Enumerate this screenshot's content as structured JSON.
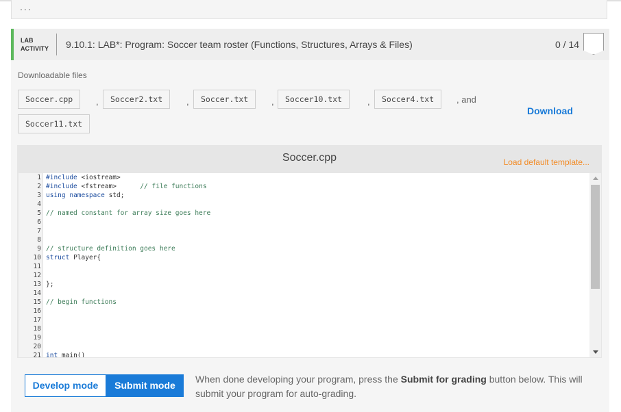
{
  "prev_section": {
    "ellipsis": "..."
  },
  "lab": {
    "type_line1": "LAB",
    "type_line2": "ACTIVITY",
    "title": "9.10.1: LAB*: Program: Soccer team roster (Functions, Structures, Arrays & Files)",
    "score": "0 / 14",
    "accent_color": "#5cb85c"
  },
  "downloads": {
    "title": "Downloadable files",
    "files": [
      "Soccer.cpp",
      "Soccer2.txt",
      "Soccer.txt",
      "Soccer10.txt",
      "Soccer4.txt",
      "Soccer11.txt"
    ],
    "separator": ",",
    "and_text": ", and",
    "download_label": "Download"
  },
  "editor": {
    "file_name": "Soccer.cpp",
    "load_default_label": "Load default template...",
    "lines": [
      {
        "n": "1",
        "code": "#include <iostream>"
      },
      {
        "n": "2",
        "code": "#include <fstream>      // file functions"
      },
      {
        "n": "3",
        "code": "using namespace std;"
      },
      {
        "n": "4",
        "code": ""
      },
      {
        "n": "5",
        "code": "// named constant for array size goes here"
      },
      {
        "n": "6",
        "code": ""
      },
      {
        "n": "7",
        "code": ""
      },
      {
        "n": "8",
        "code": ""
      },
      {
        "n": "9",
        "code": "// structure definition goes here"
      },
      {
        "n": "10",
        "code": "struct Player{"
      },
      {
        "n": "11",
        "code": ""
      },
      {
        "n": "12",
        "code": ""
      },
      {
        "n": "13",
        "code": "};"
      },
      {
        "n": "14",
        "code": ""
      },
      {
        "n": "15",
        "code": "// begin functions"
      },
      {
        "n": "16",
        "code": ""
      },
      {
        "n": "17",
        "code": ""
      },
      {
        "n": "18",
        "code": ""
      },
      {
        "n": "19",
        "code": ""
      },
      {
        "n": "20",
        "code": ""
      },
      {
        "n": "21",
        "code": "int main()"
      }
    ]
  },
  "modes": {
    "develop_label": "Develop mode",
    "submit_label": "Submit mode",
    "active": "Submit mode",
    "accent_color": "#1a7bd8"
  },
  "submit_note": {
    "before": "When done developing your program, press the ",
    "bold": "Submit for grading",
    "after": " button below. This will submit your program for auto-grading."
  }
}
